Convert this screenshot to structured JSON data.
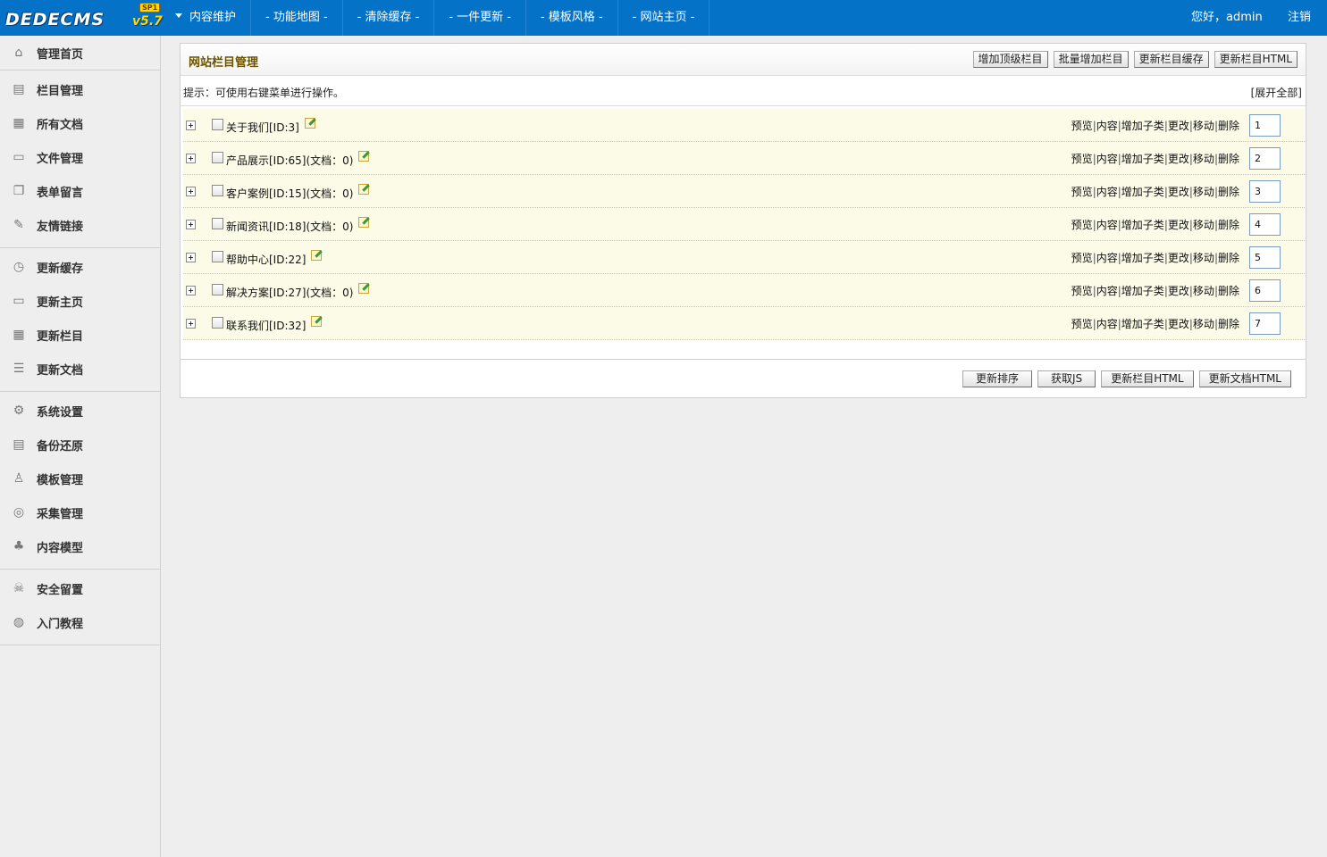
{
  "app": {
    "logo_brand": "DEDECMS",
    "logo_version": "v5.7",
    "logo_badge": "SP1"
  },
  "topnav": {
    "items": [
      "内容维护",
      "- 功能地图 -",
      "- 清除缓存 -",
      "- 一件更新 -",
      "- 模板风格 -",
      "- 网站主页 -"
    ],
    "greeting": "您好，admin",
    "logout": "注销"
  },
  "sidebar": {
    "groups": [
      [
        {
          "label": "管理首页",
          "icon": "home-icon"
        }
      ],
      [
        {
          "label": "栏目管理",
          "icon": "category-icon"
        },
        {
          "label": "所有文档",
          "icon": "documents-icon"
        },
        {
          "label": "文件管理",
          "icon": "monitor-icon"
        },
        {
          "label": "表单留言",
          "icon": "form-icon"
        },
        {
          "label": "友情链接",
          "icon": "link-icon"
        }
      ],
      [
        {
          "label": "更新缓存",
          "icon": "clock-icon"
        },
        {
          "label": "更新主页",
          "icon": "folder-icon"
        },
        {
          "label": "更新栏目",
          "icon": "calendar-icon"
        },
        {
          "label": "更新文档",
          "icon": "list-icon"
        }
      ],
      [
        {
          "label": "系统设置",
          "icon": "gear-icon"
        },
        {
          "label": "备份还原",
          "icon": "database-icon"
        },
        {
          "label": "模板管理",
          "icon": "user-icon"
        },
        {
          "label": "采集管理",
          "icon": "collect-icon"
        },
        {
          "label": "内容模型",
          "icon": "sitemap-icon"
        }
      ],
      [
        {
          "label": "安全留置",
          "icon": "skull-icon"
        },
        {
          "label": "入门教程",
          "icon": "globe-icon"
        }
      ]
    ]
  },
  "panel": {
    "title": "网站栏目管理",
    "head_buttons": [
      "增加顶级栏目",
      "批量增加栏目",
      "更新栏目缓存",
      "更新栏目HTML"
    ],
    "tip": "提示：可使用右键菜单进行操作。",
    "expand_all": "[展开全部]",
    "rows": [
      {
        "name": "关于我们[ID:3]",
        "sort": "1"
      },
      {
        "name": "产品展示[ID:65](文档：0)",
        "sort": "2"
      },
      {
        "name": "客户案例[ID:15](文档：0)",
        "sort": "3"
      },
      {
        "name": "新闻资讯[ID:18](文档：0)",
        "sort": "4"
      },
      {
        "name": "帮助中心[ID:22]",
        "sort": "5"
      },
      {
        "name": "解决方案[ID:27](文档：0)",
        "sort": "6"
      },
      {
        "name": "联系我们[ID:32]",
        "sort": "7"
      }
    ],
    "ops": [
      "预览",
      "内容",
      "增加子类",
      "更改",
      "移动",
      "删除"
    ],
    "foot_buttons": [
      "更新排序",
      "获取JS",
      "更新栏目HTML",
      "更新文档HTML"
    ]
  },
  "colors": {
    "topbar": "#0372c7",
    "row_bg": "#fbfbe8",
    "title": "#6a5300"
  }
}
